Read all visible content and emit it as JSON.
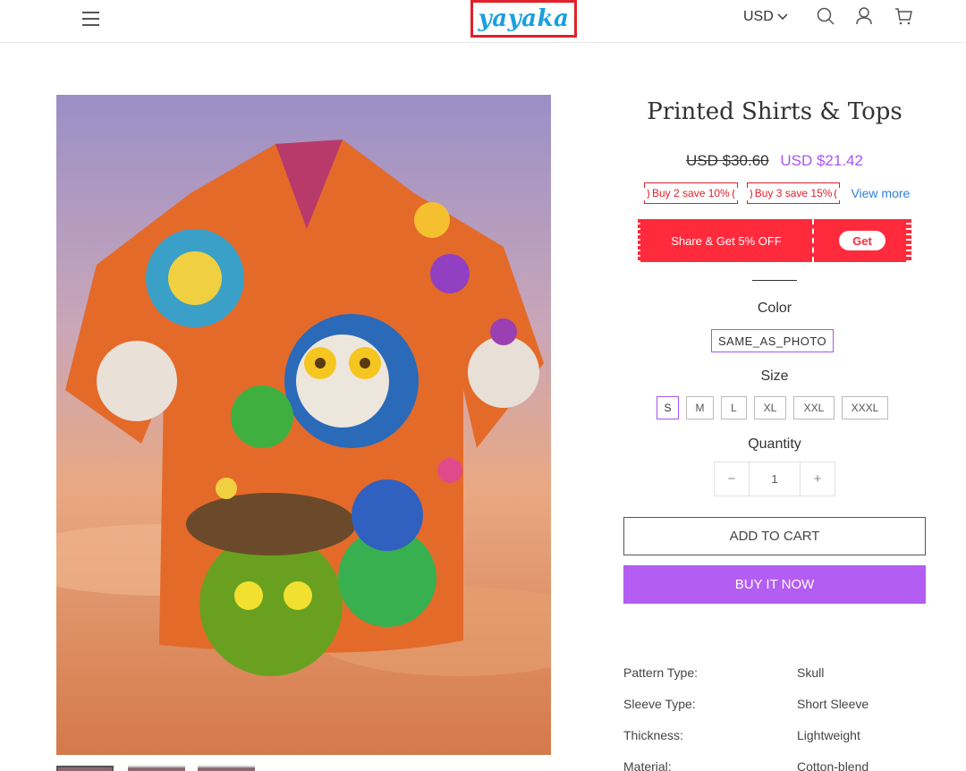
{
  "header": {
    "logo_text": "yayaka",
    "currency": "USD",
    "icons": [
      "menu-icon",
      "chevron-down-icon",
      "search-icon",
      "user-icon",
      "cart-icon"
    ]
  },
  "product": {
    "title": "Printed Shirts & Tops",
    "old_price": "USD $30.60",
    "new_price": "USD $21.42",
    "promo_tags": [
      "Buy 2 save 10%",
      "Buy 3 save 15%"
    ],
    "view_more": "View more",
    "coupon": {
      "text": "Share & Get 5% OFF",
      "button": "Get"
    },
    "color_label": "Color",
    "color_value": "SAME_AS_PHOTO",
    "size_label": "Size",
    "sizes": [
      "S",
      "M",
      "L",
      "XL",
      "XXL",
      "XXXL"
    ],
    "selected_size": "S",
    "quantity_label": "Quantity",
    "quantity": "1",
    "qty_minus": "−",
    "qty_plus": "+",
    "add_to_cart": "ADD TO CART",
    "buy_now": "BUY IT NOW",
    "specs": [
      {
        "key": "Pattern Type:",
        "value": "Skull"
      },
      {
        "key": "Sleeve Type:",
        "value": "Short Sleeve"
      },
      {
        "key": "Thickness:",
        "value": "Lightweight"
      },
      {
        "key": "Material:",
        "value": "Cotton-blend"
      }
    ]
  },
  "colors": {
    "accent": "#a855f7",
    "buy_button": "#b35df2",
    "coupon_red": "#ff2a3c",
    "tag_red": "#e0202a",
    "logo_blue": "#1aa0e0",
    "link_blue": "#2f7ee0"
  }
}
